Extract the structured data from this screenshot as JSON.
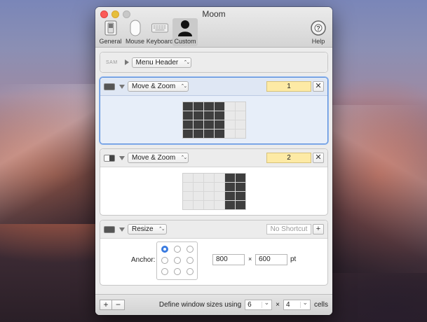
{
  "window": {
    "title": "Moom"
  },
  "toolbar": {
    "items": [
      {
        "label": "General",
        "icon": "switch-icon"
      },
      {
        "label": "Mouse",
        "icon": "mouse-icon"
      },
      {
        "label": "Keyboard",
        "icon": "keyboard-icon"
      },
      {
        "label": "Custom",
        "icon": "person-silhouette-icon",
        "selected": true
      }
    ],
    "help": {
      "label": "Help",
      "icon": "help-lifebuoy-icon"
    }
  },
  "rows": {
    "header": {
      "tag": "SAM",
      "action": "Menu Header"
    },
    "move1": {
      "action": "Move & Zoom",
      "shortcut": "1",
      "grid": {
        "cols": 6,
        "rows": 4,
        "on": [
          [
            0,
            0
          ],
          [
            0,
            1
          ],
          [
            0,
            2
          ],
          [
            0,
            3
          ],
          [
            1,
            0
          ],
          [
            1,
            1
          ],
          [
            1,
            2
          ],
          [
            1,
            3
          ],
          [
            2,
            0
          ],
          [
            2,
            1
          ],
          [
            2,
            2
          ],
          [
            2,
            3
          ],
          [
            3,
            0
          ],
          [
            3,
            1
          ],
          [
            3,
            2
          ],
          [
            3,
            3
          ]
        ]
      }
    },
    "move2": {
      "action": "Move & Zoom",
      "shortcut": "2",
      "grid": {
        "cols": 6,
        "rows": 4,
        "on": [
          [
            0,
            4
          ],
          [
            0,
            5
          ],
          [
            1,
            4
          ],
          [
            1,
            5
          ],
          [
            2,
            4
          ],
          [
            2,
            5
          ],
          [
            3,
            4
          ],
          [
            3,
            5
          ]
        ]
      }
    },
    "resize": {
      "action": "Resize",
      "shortcut_placeholder": "No Shortcut",
      "anchor_label": "Anchor:",
      "anchor_selected": "top-left",
      "width": "800",
      "height": "600",
      "times": "×",
      "unit": "pt"
    }
  },
  "bottom": {
    "add": "+",
    "remove": "−",
    "define_label": "Define window sizes using",
    "cols": "6",
    "times": "×",
    "rows": "4",
    "cells_label": "cells"
  },
  "colors": {
    "shortcut_bg": "#fdeaa5",
    "selection_border": "#5b8fdc",
    "selection_bg": "#e7eef9",
    "grid_on": "#3e3e3e"
  }
}
